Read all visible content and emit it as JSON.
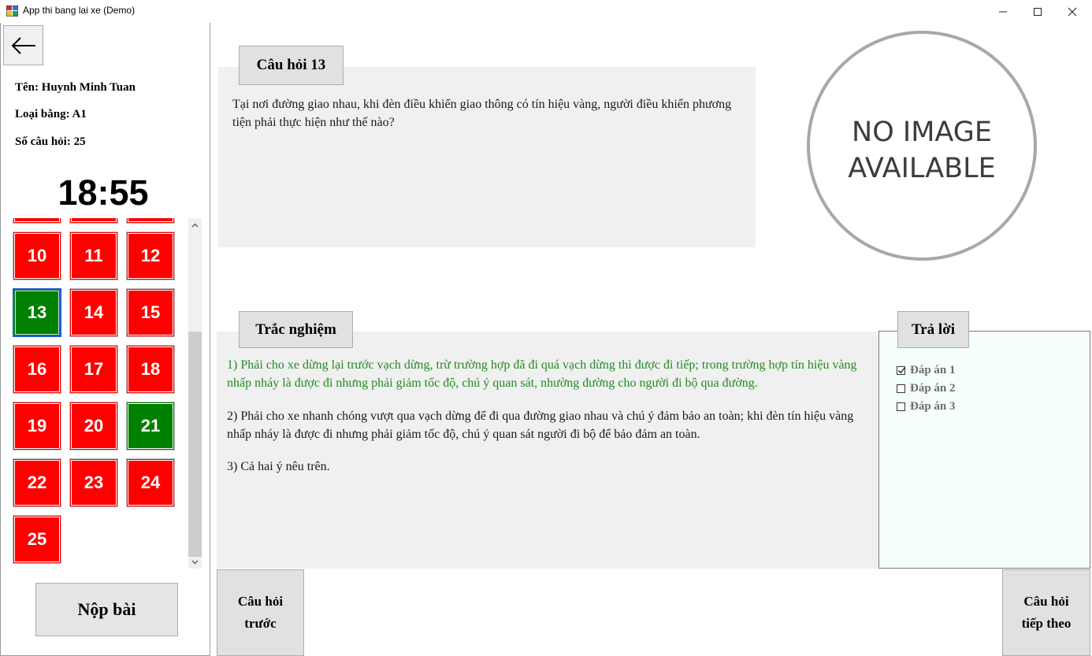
{
  "window": {
    "title": "App thi bang lai xe (Demo)",
    "controls": {
      "minimize": "—",
      "maximize": "☐",
      "close": "✕"
    }
  },
  "sidebar": {
    "name_line": "Tên: Huynh Minh Tuan",
    "license_line": "Loại bằng: A1",
    "count_line": "Số câu hỏi: 25",
    "timer": "18:55",
    "questions": [
      {
        "number": "",
        "status": "wrong"
      },
      {
        "number": "",
        "status": "wrong"
      },
      {
        "number": "",
        "status": "wrong"
      },
      {
        "number": "10",
        "status": "wrong"
      },
      {
        "number": "11",
        "status": "wrong"
      },
      {
        "number": "12",
        "status": "wrong"
      },
      {
        "number": "13",
        "status": "answered",
        "current": true
      },
      {
        "number": "14",
        "status": "wrong"
      },
      {
        "number": "15",
        "status": "wrong"
      },
      {
        "number": "16",
        "status": "wrong"
      },
      {
        "number": "17",
        "status": "wrong"
      },
      {
        "number": "18",
        "status": "wrong"
      },
      {
        "number": "19",
        "status": "wrong"
      },
      {
        "number": "20",
        "status": "wrong"
      },
      {
        "number": "21",
        "status": "answered"
      },
      {
        "number": "22",
        "status": "wrong"
      },
      {
        "number": "23",
        "status": "wrong"
      },
      {
        "number": "24",
        "status": "wrong"
      },
      {
        "number": "25",
        "status": "wrong"
      }
    ],
    "submit_label": "Nộp bài"
  },
  "question": {
    "header": "Câu hỏi 13",
    "text": "Tại nơi đường giao nhau, khi đèn điều khiển giao thông có tín hiệu vàng, người điều khiển phương tiện phải thực hiện như thế nào?",
    "image_placeholder": {
      "line1": "NO IMAGE",
      "line2": "AVAILABLE"
    }
  },
  "options": {
    "header": "Trắc nghiệm",
    "items": [
      {
        "text": "1) Phải cho xe dừng lại trước vạch dừng, trừ trường hợp đã đi quá vạch dừng thì được đi tiếp; trong trường hợp tín hiệu vàng nhấp nháy là được đi nhưng phải giảm tốc độ, chú ý quan sát, nhường đường cho người đi bộ qua đường.",
        "color": "#228b22"
      },
      {
        "text": "2) Phải cho xe nhanh chóng vượt qua vạch dừng để đi qua đường giao nhau và chú ý đảm bảo an toàn; khi đèn tín hiệu vàng nhấp nháy là được đi nhưng phải giảm tốc độ, chú ý quan sát người đi bộ để bảo đảm an toàn.",
        "color": "#1a1a1a"
      },
      {
        "text": "3) Cả hai ý nêu trên.",
        "color": "#1a1a1a"
      }
    ]
  },
  "answers": {
    "header": "Trả lời",
    "items": [
      {
        "label": "Đáp án 1",
        "checked": true
      },
      {
        "label": "Đáp án 2",
        "checked": false
      },
      {
        "label": "Đáp án 3",
        "checked": false
      }
    ]
  },
  "navigation": {
    "prev_line1": "Câu hỏi",
    "prev_line2": "trước",
    "next_line1": "Câu hỏi",
    "next_line2": "tiếp theo"
  },
  "colors": {
    "wrong": "#ff0000",
    "answered": "#008000",
    "correct_option_text": "#228b22",
    "answer_panel_bg": "#f5fff9"
  }
}
